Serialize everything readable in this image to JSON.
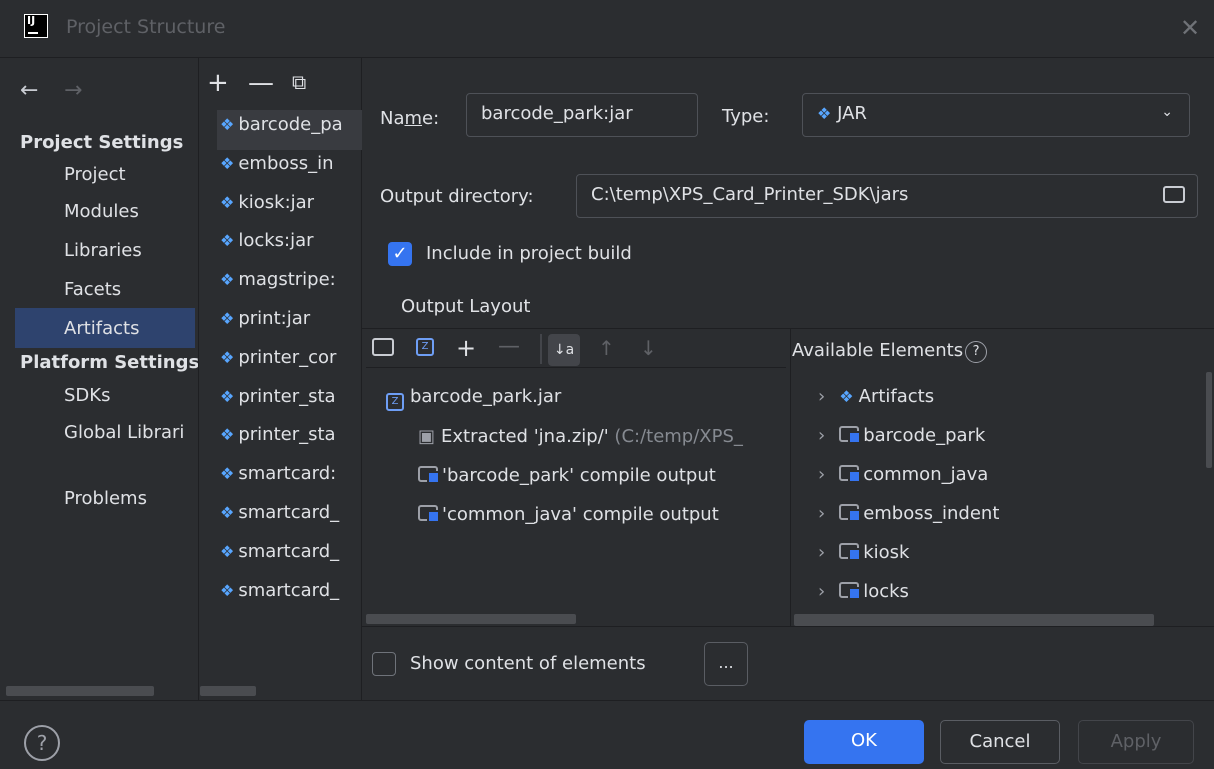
{
  "window": {
    "title": "Project Structure"
  },
  "nav": {
    "back": "←",
    "forward": "→",
    "project_settings": "Project Settings",
    "items_project": [
      "Project",
      "Modules",
      "Libraries",
      "Facets",
      "Artifacts"
    ],
    "platform_settings": "Platform Settings",
    "items_platform": [
      "SDKs",
      "Global Librari"
    ],
    "problems": "Problems",
    "selected": "Artifacts"
  },
  "artifacts": {
    "toolbar": {
      "add": "+",
      "remove": "—",
      "copy": "⧉"
    },
    "items": [
      "barcode_pa",
      "emboss_in",
      "kiosk:jar",
      "locks:jar",
      "magstripe:",
      "print:jar",
      "printer_cor",
      "printer_sta",
      "printer_sta",
      "smartcard:",
      "smartcard_",
      "smartcard_",
      "smartcard_"
    ]
  },
  "form": {
    "name_label_pre": "Na",
    "name_label_u": "m",
    "name_label_post": "e:",
    "name_value": "barcode_park:jar",
    "type_label": "Type:",
    "type_value": "JAR",
    "output_dir_label": "Output directory:",
    "output_dir_value": "C:\\temp\\XPS_Card_Printer_SDK\\jars",
    "include_build_label": "Include in project build",
    "include_build_checked": true,
    "output_layout_label": "Output Layout"
  },
  "layout_tree": {
    "root": "barcode_park.jar",
    "children": [
      {
        "text": "Extracted 'jna.zip/'",
        "suffix": " (C:/temp/XPS_"
      },
      {
        "text": "'barcode_park' compile output",
        "suffix": ""
      },
      {
        "text": "'common_java' compile output",
        "suffix": ""
      }
    ]
  },
  "available": {
    "title": "Available Elements",
    "help": "?",
    "items": [
      "Artifacts",
      "barcode_park",
      "common_java",
      "emboss_indent",
      "kiosk",
      "locks"
    ]
  },
  "show_content_label": "Show content of elements",
  "ellipsis": "...",
  "buttons": {
    "ok": "OK",
    "cancel": "Cancel",
    "apply": "Apply"
  },
  "help_icon": "?",
  "colors": {
    "accent": "#3574f0",
    "selection": "#2e436e",
    "artifact_icon": "#58a6ff"
  }
}
